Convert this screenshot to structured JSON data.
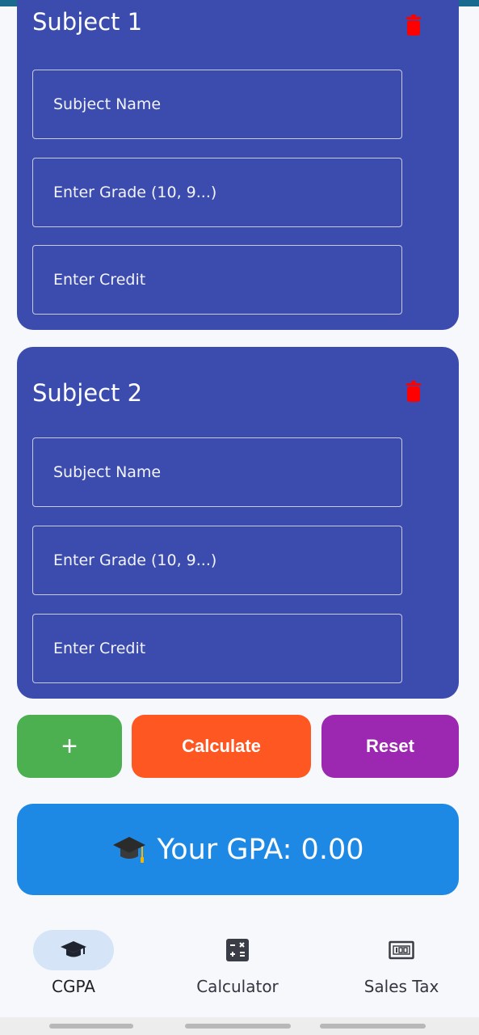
{
  "subjects": [
    {
      "title": "Subject 1",
      "fields": {
        "name_placeholder": "Subject Name",
        "grade_placeholder": "Enter Grade (10, 9...)",
        "credit_placeholder": "Enter Credit"
      }
    },
    {
      "title": "Subject 2",
      "fields": {
        "name_placeholder": "Subject Name",
        "grade_placeholder": "Enter Grade (10, 9...)",
        "credit_placeholder": "Enter Credit"
      }
    }
  ],
  "actions": {
    "add_label": "+",
    "calculate_label": "Calculate",
    "reset_label": "Reset"
  },
  "result": {
    "icon": "graduation-cap-icon",
    "text": "Your GPA: 0.00"
  },
  "bottom_nav": {
    "items": [
      {
        "label": "CGPA",
        "icon": "graduation-cap-icon",
        "active": true
      },
      {
        "label": "Calculator",
        "icon": "calculator-icon",
        "active": false
      },
      {
        "label": "Sales Tax",
        "icon": "money-icon",
        "active": false
      }
    ]
  },
  "colors": {
    "card": "#3b4cae",
    "add": "#4caf50",
    "calculate": "#ff5722",
    "reset": "#9c27b0",
    "result": "#1e88e5",
    "delete": "#ff0000"
  }
}
